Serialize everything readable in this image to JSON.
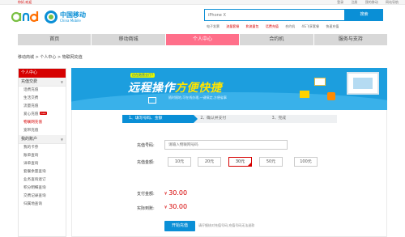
{
  "topbar": {
    "left": "你好,欢迎",
    "links": [
      "登录",
      "注册",
      "我的移动",
      "网站导航"
    ]
  },
  "logo": {
    "cn": "中国移动",
    "en": "China Mobile"
  },
  "colors": {
    "brand_blue": "#0a8fd6",
    "brand_red": "#d60000",
    "nav_active": "#ff6f8a"
  },
  "search": {
    "placeholder": "iPhone X",
    "button": "搜索"
  },
  "hotlinks": [
    {
      "label": "电子发票",
      "hot": false
    },
    {
      "label": "流量套餐",
      "hot": true
    },
    {
      "label": "和流量包",
      "hot": true
    },
    {
      "label": "话费充值",
      "hot": true
    },
    {
      "label": "合约机",
      "hot": false
    },
    {
      "label": "4G飞享套餐",
      "hot": false
    },
    {
      "label": "快速充值",
      "hot": false
    }
  ],
  "nav": [
    "首页",
    "移动商城",
    "个人中心",
    "合约机",
    "服务与支持"
  ],
  "breadcrumb": "移动商城 > 个人中心 > 物联网充值",
  "sidebar": {
    "header": "个人中心",
    "sections": [
      {
        "title": "充值交费",
        "items": [
          "话费充值",
          "生活交费",
          "流量充值",
          "爱心充值",
          "物联网充值",
          "宽带充值"
        ]
      },
      {
        "title": "我的账户",
        "items": [
          "我的卡券",
          "账单查询",
          "详单查询",
          "套餐余量查询",
          "业务查询退订",
          "积分明细查询",
          "交费记录查询",
          "归属地查询"
        ]
      }
    ],
    "new_badge": "new"
  },
  "banner": {
    "tag": "还在跑营业厅?",
    "title_a": "远程操作",
    "title_b": "方便快捷",
    "sub": "随时随地,可在线办理,一键搞定,方便省事"
  },
  "steps": [
    "1、填写号码、金额",
    "2、确认并支付",
    "3、完成"
  ],
  "form": {
    "phone_label": "充值号码:",
    "phone_placeholder": "请输入物联网号码",
    "amount_label": "充值金额:",
    "amounts": [
      "10元",
      "20元",
      "30元",
      "50元",
      "100元"
    ],
    "selected_amount": "30元",
    "pay_label": "支付金额:",
    "pay_value": "30.00",
    "actual_label": "实际到账:",
    "actual_value": "30.00",
    "currency": "¥",
    "submit": "开始充值",
    "note": "请仔细核对充值号码,充值号码无法退款"
  }
}
